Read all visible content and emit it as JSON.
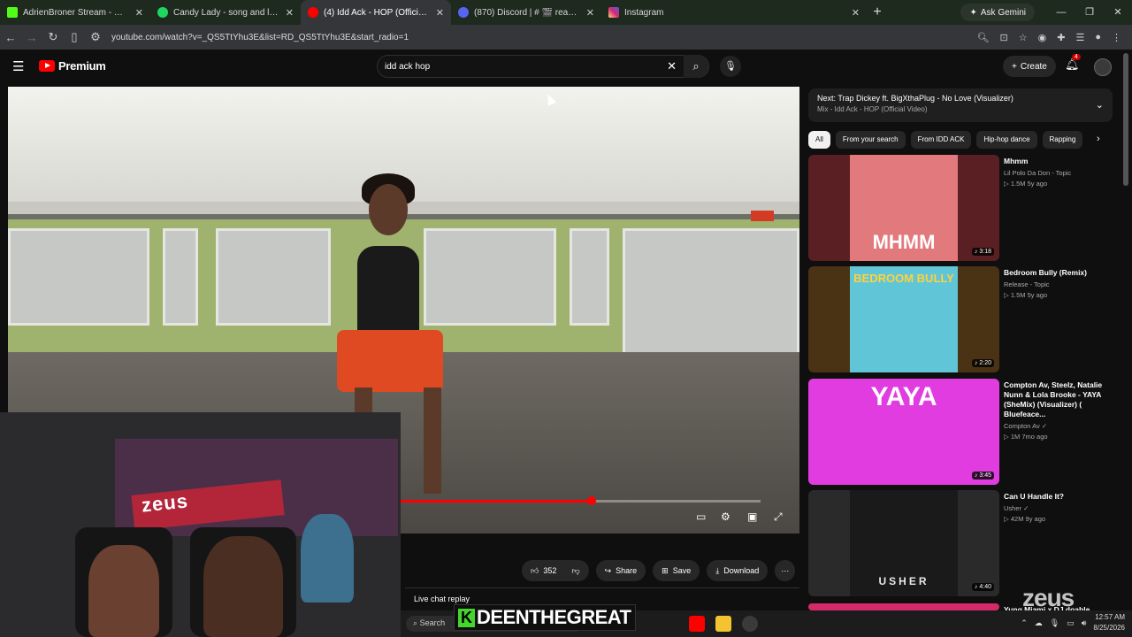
{
  "browser": {
    "tabs": [
      {
        "title": "AdrienBroner Stream - Watch L",
        "icon": "kick-icon",
        "color": "#53fc18"
      },
      {
        "title": "Candy Lady - song and lyrics by",
        "icon": "spotify-icon",
        "color": "#1ed760"
      },
      {
        "title": "(4) Idd Ack - HOP (Official V",
        "icon": "youtube-icon",
        "color": "#ff0000",
        "active": true
      },
      {
        "title": "(870) Discord | # 🎬 reactions",
        "icon": "discord-icon",
        "color": "#5865f2"
      },
      {
        "title": "Instagram",
        "icon": "instagram-icon",
        "color": "#e1306c"
      }
    ],
    "ask_gemini": "Ask Gemini",
    "url": "youtube.com/watch?v=_QS5TtYhu3E&list=RD_QS5TtYhu3E&start_radio=1"
  },
  "youtube": {
    "logo_text": "Premium",
    "search_value": "idd ack hop",
    "create_label": "Create",
    "notif_count": "4"
  },
  "video": {
    "progress_fraction": 0.53
  },
  "actions": {
    "likes": "352",
    "share": "Share",
    "save": "Save",
    "download": "Download"
  },
  "live_chat": "Live chat replay",
  "sidebar": {
    "next_title": "Next: Trap Dickey ft. BigXthaPlug - No Love (Visualizer)",
    "next_sub": "Mix - Idd Ack - HOP (Official Video)",
    "chips": [
      "All",
      "From your search",
      "From IDD ACK",
      "Hip-hop dance",
      "Rapping"
    ],
    "recs": [
      {
        "title": "Mhmm",
        "channel": "Lil Polo Da Don - Topic",
        "stats": "▷ 1.5M  5y ago",
        "duration": "♪ 3:18",
        "art": "MHMM",
        "bg": "#5a1f22",
        "art_bg": "#e27a7d",
        "art_color": "#ffffff"
      },
      {
        "title": "Bedroom Bully (Remix)",
        "channel": "Release - Topic",
        "stats": "▷ 1.5M  5y ago",
        "duration": "♪ 2:20",
        "art": "BEDROOM BULLY",
        "bg": "#4a3214",
        "art_bg": "#61c5d8",
        "art_color": "#ffd23a"
      },
      {
        "title": "Compton Av, Steelz, Natalie Nunn & Lola Brooke - YAYA (SheMix) (Visualizer) ( Bluefeace...",
        "channel": "Compton Av ✓",
        "stats": "▷ 1M  7mo ago",
        "duration": "♪ 3:45",
        "art": "YAYA",
        "bg": "#d633d6",
        "art_bg": "#e03ce0",
        "art_color": "#ffffff"
      },
      {
        "title": "Can U Handle It?",
        "channel": "Usher ✓",
        "stats": "▷ 42M  9y ago",
        "duration": "♪ 4:40",
        "art": "USHER",
        "bg": "#2a2a2a",
        "art_bg": "#1a1a1a",
        "art_color": "#e8e8e8"
      }
    ],
    "partial_title": "Yung Miami x DJ doable"
  },
  "taskbar": {
    "search": "Search",
    "overlay_k": "K",
    "overlay_text": "DEENTHEGREAT",
    "time": "12:57 AM",
    "date": "8/25/2026"
  },
  "watermark": "zeus"
}
